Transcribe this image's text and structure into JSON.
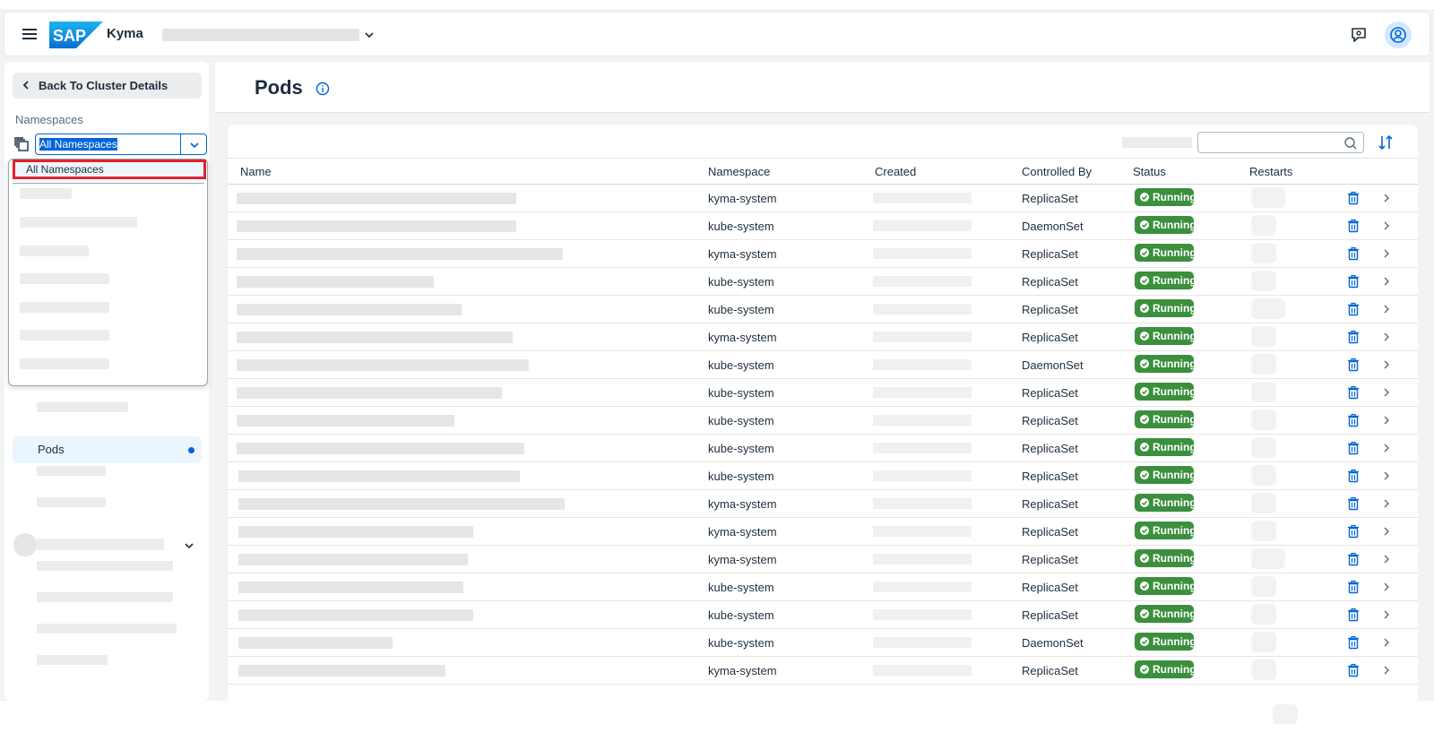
{
  "shell": {
    "product": "Kyma",
    "logo_text": "SAP",
    "icons": [
      "hamburger-icon",
      "feedback-icon",
      "user-avatar-icon"
    ]
  },
  "sidebar": {
    "back_label": "Back To Cluster Details",
    "namespaces_label": "Namespaces",
    "namespace_value": "All Namespaces",
    "dropdown_selected": "All Namespaces",
    "active_item": "Pods"
  },
  "page": {
    "title": "Pods"
  },
  "table": {
    "headers": {
      "name": "Name",
      "namespace": "Namespace",
      "created": "Created",
      "controlled_by": "Controlled By",
      "status": "Status",
      "restarts": "Restarts"
    },
    "rows": [
      {
        "namespace": "kyma-system",
        "controlled_by": "ReplicaSet",
        "status": "Running"
      },
      {
        "namespace": "kube-system",
        "controlled_by": "DaemonSet",
        "status": "Running"
      },
      {
        "namespace": "kyma-system",
        "controlled_by": "ReplicaSet",
        "status": "Running"
      },
      {
        "namespace": "kube-system",
        "controlled_by": "ReplicaSet",
        "status": "Running"
      },
      {
        "namespace": "kube-system",
        "controlled_by": "ReplicaSet",
        "status": "Running"
      },
      {
        "namespace": "kyma-system",
        "controlled_by": "ReplicaSet",
        "status": "Running"
      },
      {
        "namespace": "kube-system",
        "controlled_by": "DaemonSet",
        "status": "Running"
      },
      {
        "namespace": "kube-system",
        "controlled_by": "ReplicaSet",
        "status": "Running"
      },
      {
        "namespace": "kube-system",
        "controlled_by": "ReplicaSet",
        "status": "Running"
      },
      {
        "namespace": "kube-system",
        "controlled_by": "ReplicaSet",
        "status": "Running"
      },
      {
        "namespace": "kube-system",
        "controlled_by": "ReplicaSet",
        "status": "Running"
      },
      {
        "namespace": "kyma-system",
        "controlled_by": "ReplicaSet",
        "status": "Running"
      },
      {
        "namespace": "kyma-system",
        "controlled_by": "ReplicaSet",
        "status": "Running"
      },
      {
        "namespace": "kyma-system",
        "controlled_by": "ReplicaSet",
        "status": "Running"
      },
      {
        "namespace": "kube-system",
        "controlled_by": "ReplicaSet",
        "status": "Running"
      },
      {
        "namespace": "kube-system",
        "controlled_by": "ReplicaSet",
        "status": "Running"
      },
      {
        "namespace": "kube-system",
        "controlled_by": "DaemonSet",
        "status": "Running"
      },
      {
        "namespace": "kyma-system",
        "controlled_by": "ReplicaSet",
        "status": "Running"
      }
    ]
  },
  "colors": {
    "accent": "#0064d9",
    "status_running": "#3b8f3d",
    "highlight_border": "#e5202e"
  }
}
